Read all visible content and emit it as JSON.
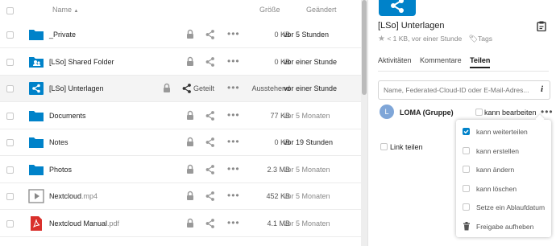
{
  "header": {
    "name_col": "Name",
    "sort_indicator": "▲",
    "size_col": "Größe",
    "modified_col": "Geändert"
  },
  "files": [
    {
      "name": "_Private",
      "ext": "",
      "type": "folder",
      "size": "0 KB",
      "modified": "vor 5 Stunden",
      "modified_grey": false,
      "shared": false
    },
    {
      "name": "[LSo] Shared Folder",
      "ext": "",
      "type": "folder-shared",
      "size": "0 KB",
      "modified": "vor einer Stunde",
      "modified_grey": false,
      "shared": false
    },
    {
      "name": "[LSo] Unterlagen",
      "ext": "",
      "type": "share-folder",
      "size": "Ausstehend",
      "modified": "vor einer Stunde",
      "modified_grey": false,
      "shared": true,
      "shared_label": "Geteilt"
    },
    {
      "name": "Documents",
      "ext": "",
      "type": "folder",
      "size": "77 KB",
      "modified": "vor 5 Monaten",
      "modified_grey": true,
      "shared": false
    },
    {
      "name": "Notes",
      "ext": "",
      "type": "folder",
      "size": "0 KB",
      "modified": "vor 19 Stunden",
      "modified_grey": false,
      "shared": false
    },
    {
      "name": "Photos",
      "ext": "",
      "type": "folder",
      "size": "2.3 MB",
      "modified": "vor 5 Monaten",
      "modified_grey": true,
      "shared": false
    },
    {
      "name": "Nextcloud",
      "ext": ".mp4",
      "type": "video",
      "size": "452 KB",
      "modified": "vor 5 Monaten",
      "modified_grey": true,
      "shared": false
    },
    {
      "name": "Nextcloud Manual",
      "ext": ".pdf",
      "type": "pdf",
      "size": "4.1 MB",
      "modified": "vor 5 Monaten",
      "modified_grey": true,
      "shared": false
    }
  ],
  "sidebar": {
    "title": "[LSo] Unterlagen",
    "meta": "< 1 KB, vor einer Stunde",
    "tags_label": "Tags",
    "tabs": [
      "Aktivitäten",
      "Kommentare",
      "Teilen"
    ],
    "active_tab": "Teilen",
    "share_placeholder": "Name, Federated-Cloud-ID oder E-Mail-Adres...",
    "info_glyph": "i",
    "share_user": {
      "initial": "L",
      "name": "LOMA (Gruppe)",
      "edit_label": "kann bearbeiten",
      "avatar_color": "#7fa6d8"
    },
    "link_label": "Link teilen"
  },
  "popover": {
    "items": [
      {
        "label": "kann weiterteilen",
        "kind": "checkbox",
        "checked": true
      },
      {
        "label": "kann erstellen",
        "kind": "checkbox",
        "checked": false
      },
      {
        "label": "kann ändern",
        "kind": "checkbox",
        "checked": false
      },
      {
        "label": "kann löschen",
        "kind": "checkbox",
        "checked": false
      },
      {
        "label": "Setze ein Ablaufdatum",
        "kind": "checkbox",
        "checked": false
      },
      {
        "label": "Freigabe aufheben",
        "kind": "action",
        "checked": false
      }
    ]
  },
  "colors": {
    "accent": "#0082c9",
    "folder": "#0082c9",
    "pdf": "#d9302c"
  }
}
